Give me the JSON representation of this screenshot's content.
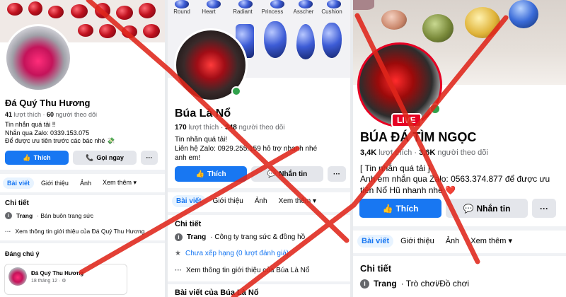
{
  "panel1": {
    "name": "Đá Quý Thu Hương",
    "likes_count": "41",
    "likes_label": "lượt thích",
    "followers_count": "60",
    "followers_label": "người theo dõi",
    "bio": [
      "Tin nhắn quá tải !!",
      "Nhắn qua Zalo: 0339.153.075",
      "Để được ưu tiên trước các bác nhé 💸"
    ],
    "like_button": "Thích",
    "call_button": "Gọi ngay",
    "more_button": "···",
    "tabs": [
      "Bài viết",
      "Giới thiệu",
      "Ảnh",
      "Xem thêm"
    ],
    "details_heading": "Chi tiết",
    "detail_page_label": "Trang",
    "detail_page_value": "· Bán buôn trang sức",
    "detail_more": "Xem thông tin giới thiệu của Đá Quý Thu Hương",
    "notable_heading": "Đáng chú ý",
    "post_name": "Đá Quý Thu Hương",
    "post_date": "18 tháng 12 · ⚙"
  },
  "panel2": {
    "shape_labels": [
      "Round",
      "Heart",
      "Radiant",
      "Princess",
      "Asscher",
      "Cushion"
    ],
    "name": "Búa Là Nổ",
    "likes_count": "170",
    "likes_label": "lượt thích",
    "followers_count": "348",
    "followers_label": "người theo dõi",
    "bio": [
      "Tin nhắn quá tải!",
      "Liên hệ Zalo: 0929.255.159 hỗ trợ",
      "anh em!"
    ],
    "bio_tail": "nhanh nhé",
    "like_button": "Thích",
    "message_button": "Nhắn tin",
    "more_button": "···",
    "tabs": [
      "Bài viết",
      "Giới thiệu",
      "Ảnh",
      "Xem thêm"
    ],
    "details_heading": "Chi tiết",
    "detail_page_label": "Trang",
    "detail_page_value": "· Công ty trang sức & đồng hồ",
    "detail_rating": "Chưa xếp hạng (0 lượt đánh giá)",
    "detail_more": "Xem thông tin giới thiệu của Búa Là Nổ",
    "posts_heading": "Bài viết của Búa Là Nổ"
  },
  "panel3": {
    "live_badge": "LIVE",
    "name": "BÚA ĐÁ TÌM NGỌC",
    "likes_count": "3,4K",
    "likes_label": "lượt thích",
    "followers_count": "3,6K",
    "followers_label": "người theo dõi",
    "bio": [
      "[ Tin nhắn quá tải ]",
      "Anh em nhắn qua Zalo: 0563.374.877 để được ưu",
      "tiên Nổ Hũ nhanh nhé ❤️"
    ],
    "like_button": "Thích",
    "message_button": "Nhắn tin",
    "more_button": "···",
    "tabs": [
      "Bài viết",
      "Giới thiệu",
      "Ảnh",
      "Xem thêm"
    ],
    "details_heading": "Chi tiết",
    "detail_page_label": "Trang",
    "detail_page_value": "· Trò chơi/Đồ chơi"
  },
  "colors": {
    "facebook_blue": "#1877f2",
    "button_gray": "#e4e6eb",
    "cross_red": "#e0261b",
    "online_green": "#31a24c",
    "live_red": "#e60023"
  },
  "icons": [
    "thumbs-up-icon",
    "phone-icon",
    "messenger-icon",
    "info-icon",
    "star-icon",
    "dots-icon",
    "chevron-down-icon"
  ]
}
